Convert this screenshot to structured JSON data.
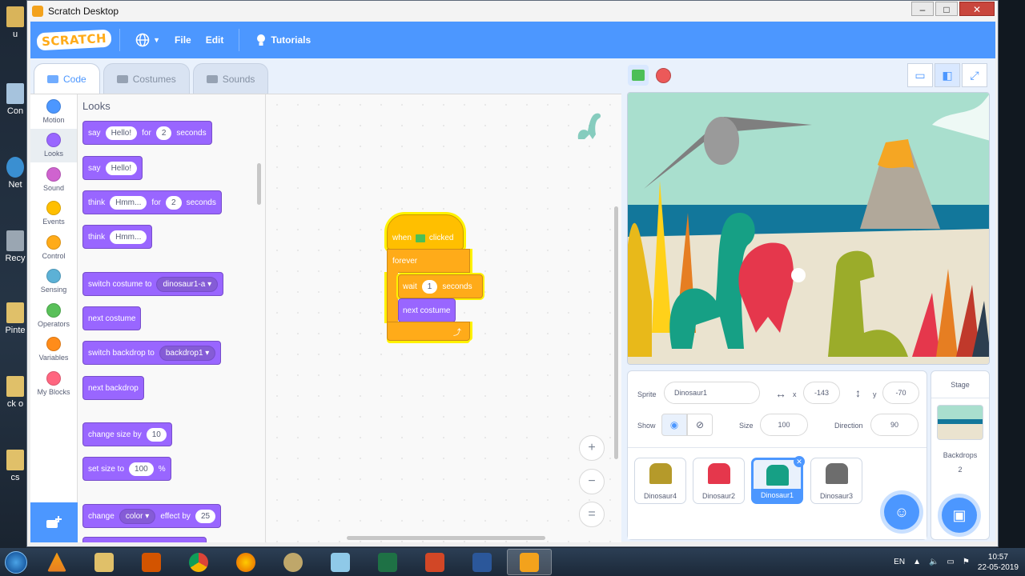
{
  "window": {
    "title": "Scratch Desktop"
  },
  "desktop_icons": [
    "u",
    "Con",
    "Net",
    "Recy",
    "Pinte",
    "ck o",
    "cs"
  ],
  "menu": {
    "logo": "SCRATCH",
    "file": "File",
    "edit": "Edit",
    "tutorials": "Tutorials"
  },
  "tabs": {
    "code": "Code",
    "costumes": "Costumes",
    "sounds": "Sounds"
  },
  "categories": [
    {
      "label": "Motion",
      "color": "#4c97ff"
    },
    {
      "label": "Looks",
      "color": "#9966ff"
    },
    {
      "label": "Sound",
      "color": "#cf63cf"
    },
    {
      "label": "Events",
      "color": "#ffbf00"
    },
    {
      "label": "Control",
      "color": "#ffab19"
    },
    {
      "label": "Sensing",
      "color": "#5cb1d6"
    },
    {
      "label": "Operators",
      "color": "#59c059"
    },
    {
      "label": "Variables",
      "color": "#ff8c1a"
    },
    {
      "label": "My Blocks",
      "color": "#ff6680"
    }
  ],
  "palette": {
    "title": "Looks",
    "say_for": {
      "say": "say",
      "msg": "Hello!",
      "for": "for",
      "secs": "2",
      "seconds": "seconds"
    },
    "say": {
      "say": "say",
      "msg": "Hello!"
    },
    "think_for": {
      "think": "think",
      "msg": "Hmm...",
      "for": "for",
      "secs": "2",
      "seconds": "seconds"
    },
    "think": {
      "think": "think",
      "msg": "Hmm..."
    },
    "switch_costume": {
      "label": "switch costume to",
      "value": "dinosaur1-a"
    },
    "next_costume": "next costume",
    "switch_backdrop": {
      "label": "switch backdrop to",
      "value": "backdrop1"
    },
    "next_backdrop": "next backdrop",
    "change_size": {
      "label": "change size by",
      "value": "10"
    },
    "set_size": {
      "label": "set size to",
      "value": "100",
      "unit": "%"
    },
    "change_effect": {
      "label": "change",
      "effect": "color",
      "by": "effect by",
      "value": "25"
    }
  },
  "script": {
    "when": "when",
    "clicked": "clicked",
    "forever": "forever",
    "wait": "wait",
    "wait_value": "1",
    "seconds": "seconds",
    "next_costume": "next costume",
    "loop_arrow": "⤴"
  },
  "zoom": {
    "in": "+",
    "out": "−",
    "reset": "="
  },
  "sprite_info": {
    "sprite_label": "Sprite",
    "sprite_name": "Dinosaur1",
    "x_label": "x",
    "x": "-143",
    "y_label": "y",
    "y": "-70",
    "show_label": "Show",
    "size_label": "Size",
    "size": "100",
    "direction_label": "Direction",
    "direction": "90"
  },
  "sprites": [
    {
      "name": "Dinosaur4",
      "color": "#b59a2a"
    },
    {
      "name": "Dinosaur2",
      "color": "#e5374c"
    },
    {
      "name": "Dinosaur1",
      "color": "#16a085"
    },
    {
      "name": "Dinosaur3",
      "color": "#6d6d6d"
    }
  ],
  "stage_pane": {
    "title": "Stage",
    "backdrops_label": "Backdrops",
    "backdrops_count": "2"
  },
  "taskbar": {
    "lang": "EN",
    "time": "10:57",
    "date": "22-05-2019"
  }
}
